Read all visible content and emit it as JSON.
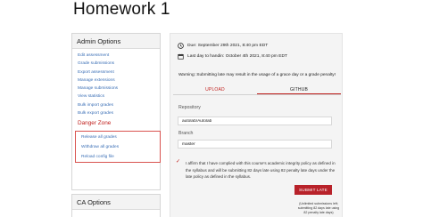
{
  "page": {
    "title": "Homework 1"
  },
  "admin_options": {
    "heading": "Admin Options",
    "links": [
      {
        "label": "Edit assessment"
      },
      {
        "label": "Grade submissions"
      },
      {
        "label": "Export assessment"
      },
      {
        "label": "Manage extensions"
      },
      {
        "label": "Manage submissions"
      },
      {
        "label": "View statistics"
      },
      {
        "label": "Bulk import grades"
      },
      {
        "label": "Bulk export grades"
      }
    ],
    "danger_zone": {
      "heading": "Danger Zone",
      "links": [
        {
          "label": "Release all grades"
        },
        {
          "label": "Withdraw all grades"
        },
        {
          "label": "Reload config file"
        }
      ]
    }
  },
  "ca_options": {
    "heading": "CA Options"
  },
  "assessment": {
    "due_date": "Due: September 29th 2021, 8:40 pm EDT",
    "last_day": "Last day to handin: October 4th 2021, 8:40 pm EDT",
    "warning": "Warning: Submitting late may result in the usage of a grace day or a grade penalty!",
    "tabs": [
      {
        "label": "UPLOAD"
      },
      {
        "label": "GITHUB"
      }
    ],
    "repository": {
      "label": "Repository",
      "value": "autolab/Autolab"
    },
    "branch": {
      "label": "Branch",
      "value": "master"
    },
    "affirmation": "I affirm that I have complied with this course's academic integrity policy as defined in the syllabus and will be submitting 82 days late using 82 penalty late days under the late policy as defined in the syllabus.",
    "submit_label": "SUBMIT LATE",
    "submission_notice": "(Unlimited submissions left; submitting 82 days late using 82 penalty late days)"
  },
  "colors": {
    "accent": "#c0201d",
    "link": "#3b6fb6",
    "submit_bg": "#b8222a"
  }
}
